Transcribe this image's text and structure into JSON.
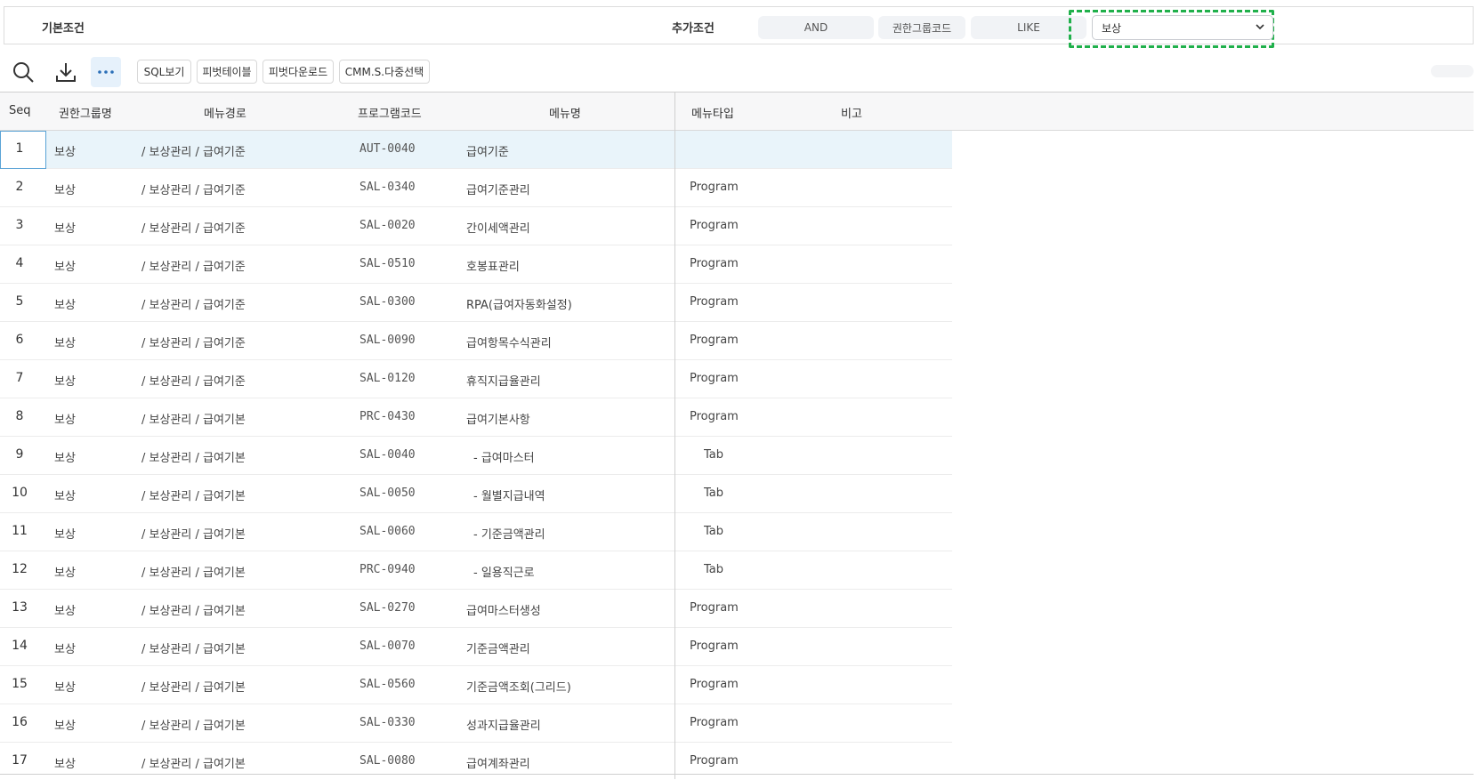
{
  "conditions": {
    "basic_label": "기본조건",
    "extra_label": "추가조건",
    "operator": "AND",
    "field": "권한그룹코드",
    "match": "LIKE",
    "value": "보상"
  },
  "toolbar": {
    "buttons": {
      "sql": "SQL보기",
      "pivot_table": "피벗테이블",
      "pivot_download": "피벗다운로드",
      "multi_select": "CMM.S.다중선택"
    },
    "icons": [
      "search-icon",
      "download-icon",
      "more-icon"
    ]
  },
  "grid": {
    "columns": {
      "seq": "Seq",
      "group": "권한그룹명",
      "path": "메뉴경로",
      "code": "프로그램코드",
      "name": "메뉴명",
      "type": "메뉴타입",
      "note": "비고"
    },
    "rows": [
      {
        "seq": "1",
        "group": "보상",
        "path": "/ 보상관리 / 급여기준",
        "code": "AUT-0040",
        "name": "급여기준",
        "type": ""
      },
      {
        "seq": "2",
        "group": "보상",
        "path": "/ 보상관리 / 급여기준",
        "code": "SAL-0340",
        "name": "급여기준관리",
        "type": "Program"
      },
      {
        "seq": "3",
        "group": "보상",
        "path": "/ 보상관리 / 급여기준",
        "code": "SAL-0020",
        "name": "간이세액관리",
        "type": "Program"
      },
      {
        "seq": "4",
        "group": "보상",
        "path": "/ 보상관리 / 급여기준",
        "code": "SAL-0510",
        "name": "호봉표관리",
        "type": "Program"
      },
      {
        "seq": "5",
        "group": "보상",
        "path": "/ 보상관리 / 급여기준",
        "code": "SAL-0300",
        "name": "RPA(급여자동화설정)",
        "type": "Program"
      },
      {
        "seq": "6",
        "group": "보상",
        "path": "/ 보상관리 / 급여기준",
        "code": "SAL-0090",
        "name": "급여항목수식관리",
        "type": "Program"
      },
      {
        "seq": "7",
        "group": "보상",
        "path": "/ 보상관리 / 급여기준",
        "code": "SAL-0120",
        "name": "휴직지급율관리",
        "type": "Program"
      },
      {
        "seq": "8",
        "group": "보상",
        "path": "/ 보상관리 / 급여기본",
        "code": "PRC-0430",
        "name": "급여기본사항",
        "type": "Program"
      },
      {
        "seq": "9",
        "group": "보상",
        "path": "/ 보상관리 / 급여기본",
        "code": "SAL-0040",
        "name": "- 급여마스터",
        "type": "Tab"
      },
      {
        "seq": "10",
        "group": "보상",
        "path": "/ 보상관리 / 급여기본",
        "code": "SAL-0050",
        "name": "- 월별지급내역",
        "type": "Tab"
      },
      {
        "seq": "11",
        "group": "보상",
        "path": "/ 보상관리 / 급여기본",
        "code": "SAL-0060",
        "name": "- 기준금액관리",
        "type": "Tab"
      },
      {
        "seq": "12",
        "group": "보상",
        "path": "/ 보상관리 / 급여기본",
        "code": "PRC-0940",
        "name": "- 일용직근로",
        "type": "Tab"
      },
      {
        "seq": "13",
        "group": "보상",
        "path": "/ 보상관리 / 급여기본",
        "code": "SAL-0270",
        "name": "급여마스터생성",
        "type": "Program"
      },
      {
        "seq": "14",
        "group": "보상",
        "path": "/ 보상관리 / 급여기본",
        "code": "SAL-0070",
        "name": "기준금액관리",
        "type": "Program"
      },
      {
        "seq": "15",
        "group": "보상",
        "path": "/ 보상관리 / 급여기본",
        "code": "SAL-0560",
        "name": "기준금액조회(그리드)",
        "type": "Program"
      },
      {
        "seq": "16",
        "group": "보상",
        "path": "/ 보상관리 / 급여기본",
        "code": "SAL-0330",
        "name": "성과지급율관리",
        "type": "Program"
      },
      {
        "seq": "17",
        "group": "보상",
        "path": "/ 보상관리 / 급여기본",
        "code": "SAL-0080",
        "name": "급여계좌관리",
        "type": "Program"
      }
    ],
    "selected_row": 1,
    "highlight_color": "#20b04b",
    "selected_row_color": "#e9f4fa"
  }
}
